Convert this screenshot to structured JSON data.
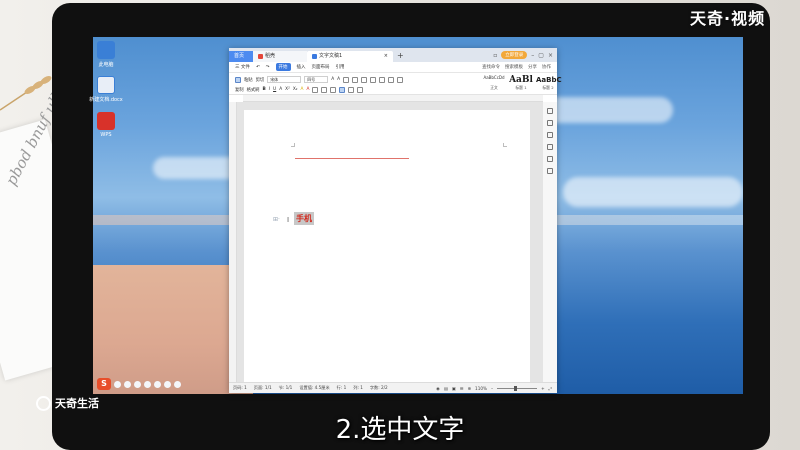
{
  "watermarks": {
    "top_right": "天奇·视频",
    "bottom_left": "天奇生活"
  },
  "caption": "2.选中文字",
  "background": {
    "script_text": "pbod bnuf ulloo"
  },
  "desktop": {
    "icons": [
      {
        "label": "此电脑",
        "color": "#3a7fd6"
      },
      {
        "label": "新建文档.docx",
        "color": "#e8eef7"
      },
      {
        "label": "WPS",
        "color": "#d8322a"
      }
    ]
  },
  "app": {
    "tabs": {
      "home": "首页",
      "doc": "稻壳",
      "active": "文字文稿1"
    },
    "login_label": "立即登录",
    "menu": {
      "file": "三 文件",
      "items": [
        "开始",
        "插入",
        "页面布局",
        "引用"
      ],
      "right": [
        "查找命令",
        "搜索模板",
        "分享",
        "协作"
      ]
    },
    "ribbon": {
      "clipboard": [
        "粘贴",
        "剪切",
        "复制",
        "格式刷"
      ],
      "font_name": "宋体",
      "font_size": "四号",
      "styles": [
        {
          "preview": "AaBbCcDd",
          "name": "正文"
        },
        {
          "preview": "AaBl",
          "name": "标题 1"
        },
        {
          "preview": "AaBbC",
          "name": "标题 2"
        }
      ]
    },
    "document": {
      "selected_text": "手机"
    },
    "status": {
      "page": "页码: 1",
      "pages": "页面: 1/1",
      "section": "节: 1/1",
      "setting": "设置值: 4.5厘米",
      "row": "行: 1",
      "col": "列: 1",
      "words": "字数: 2/2",
      "zoom": "110%"
    }
  }
}
